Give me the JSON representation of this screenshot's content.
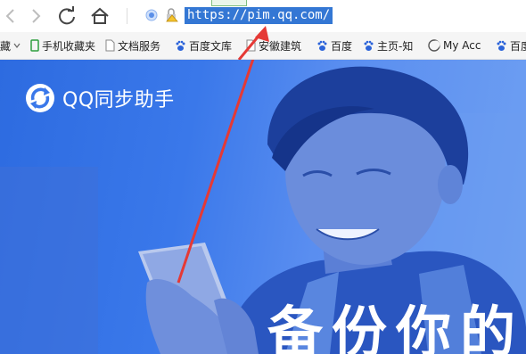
{
  "browser": {
    "url": "https://pim.qq.com/",
    "bookmarks": [
      {
        "label": "藏",
        "icon": "chevron-left-icon"
      },
      {
        "label": "手机收藏夹",
        "icon": "phone-icon"
      },
      {
        "label": "文档服务",
        "icon": "document-icon"
      },
      {
        "label": "百度文库",
        "icon": "baidu-paw-icon"
      },
      {
        "label": "安徽建筑",
        "icon": "document-icon"
      },
      {
        "label": "百度",
        "icon": "baidu-paw-icon"
      },
      {
        "label": "主页-知",
        "icon": "baidu-paw-icon"
      },
      {
        "label": "My Acc",
        "icon": "crescent-icon"
      },
      {
        "label": "百度",
        "icon": "baidu-paw-icon"
      }
    ]
  },
  "page": {
    "logo_text": "QQ同步助手",
    "headline": "备份你的"
  },
  "colors": {
    "hero_blue": "#3a78ea",
    "selection_blue": "#3477d4",
    "annotation_red": "#e53935"
  }
}
